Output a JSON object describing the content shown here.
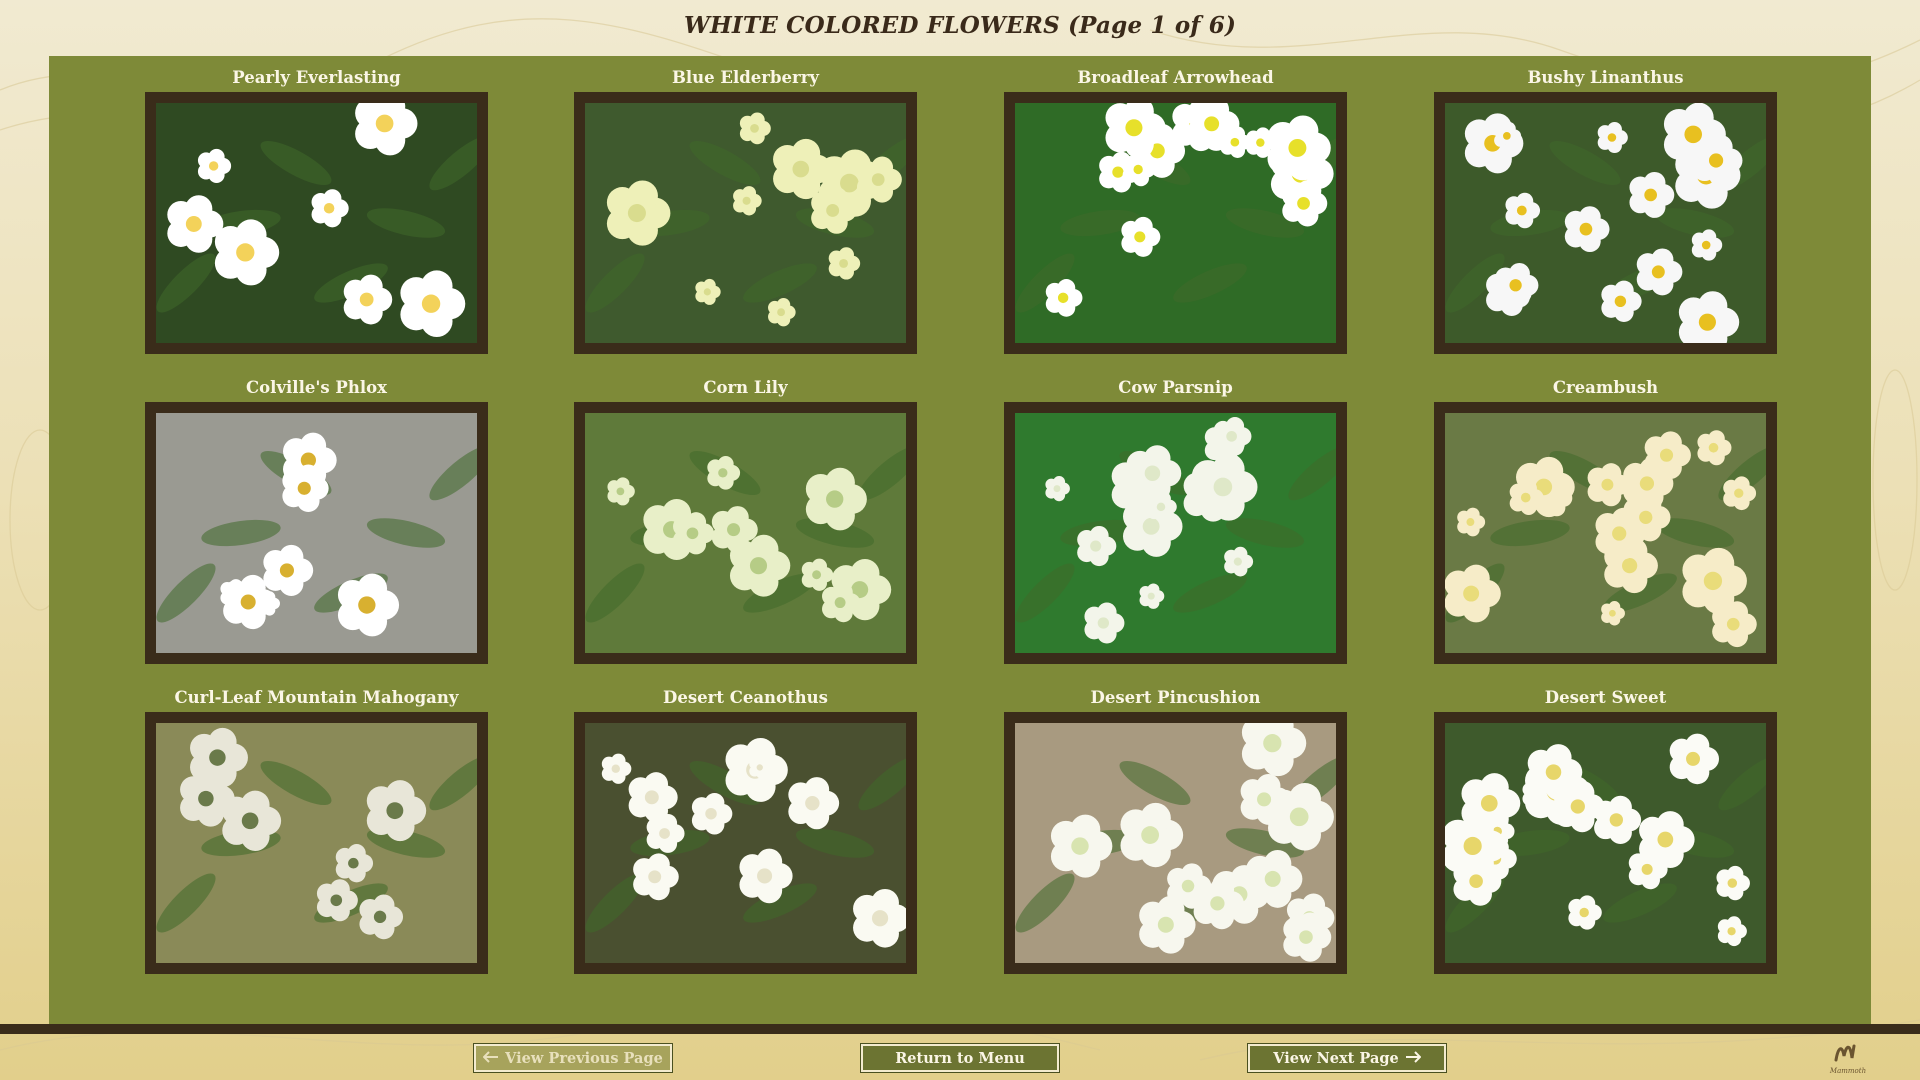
{
  "page": {
    "title": "WHITE COLORED FLOWERS (Page 1 of  6)"
  },
  "colors": {
    "panel": "#7e8a38",
    "frame": "#3a2c1a",
    "button": "#6c7432",
    "background": "#ece0b6"
  },
  "flowers": [
    {
      "name": "Pearly Everlasting",
      "palette": [
        "#2f4a22",
        "#ffffff",
        "#f3d25a"
      ]
    },
    {
      "name": "Blue Elderberry",
      "palette": [
        "#3f5a2e",
        "#eef0b8",
        "#d9dc8e"
      ]
    },
    {
      "name": "Broadleaf Arrowhead",
      "palette": [
        "#2f6b26",
        "#ffffff",
        "#e7e02a"
      ]
    },
    {
      "name": "Bushy Linanthus",
      "palette": [
        "#3d5a2a",
        "#f7f7f7",
        "#e8c020"
      ]
    },
    {
      "name": "Colville's Phlox",
      "palette": [
        "#9a9a92",
        "#ffffff",
        "#d8b030"
      ]
    },
    {
      "name": "Corn Lily",
      "palette": [
        "#5f7a3a",
        "#e8efc8",
        "#b6cc86"
      ]
    },
    {
      "name": "Cow Parsnip",
      "palette": [
        "#2f7a2e",
        "#f3f5ea",
        "#dfe8c8"
      ]
    },
    {
      "name": "Creambush",
      "palette": [
        "#6a7a45",
        "#f6ecc8",
        "#e9dc7a"
      ]
    },
    {
      "name": "Curl-Leaf Mountain Mahogany",
      "palette": [
        "#8a8a58",
        "#e8e6d8",
        "#6a7a4a"
      ]
    },
    {
      "name": "Desert Ceanothus",
      "palette": [
        "#4a5030",
        "#fafaf2",
        "#e6e2c8"
      ]
    },
    {
      "name": "Desert Pincushion",
      "palette": [
        "#a89a80",
        "#f7f7ee",
        "#d8e4b0"
      ]
    },
    {
      "name": "Desert Sweet",
      "palette": [
        "#3e5a2c",
        "#fbfbf6",
        "#e7d66a"
      ]
    }
  ],
  "nav": {
    "prev_label": "View Previous Page",
    "menu_label": "Return to Menu",
    "next_label": "View Next Page",
    "prev_icon": "arrow-left-icon",
    "next_icon": "arrow-right-icon",
    "logo_icon": "mammoth-logo-icon"
  },
  "logo": {
    "text": "Mammoth"
  }
}
